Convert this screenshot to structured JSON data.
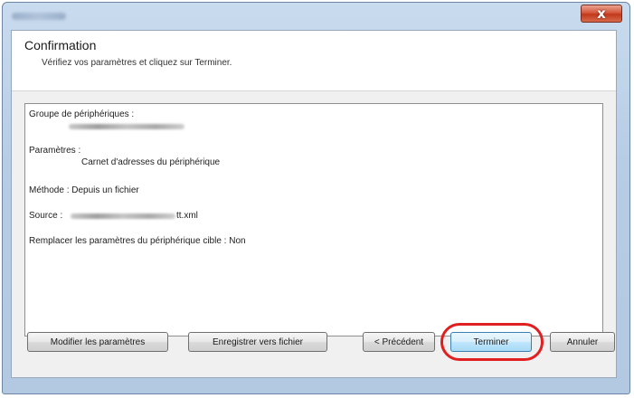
{
  "window": {
    "close_label": "x"
  },
  "header": {
    "title": "Confirmation",
    "subtitle": "Vérifiez vos paramètres et cliquez sur Terminer."
  },
  "summary": {
    "device_group_label": "Groupe de périphériques :",
    "settings_label": "Paramètres :",
    "settings_value": "Carnet d'adresses du périphérique",
    "method_line": "Méthode : Depuis un fichier",
    "source_label": "Source :",
    "source_suffix": "tt.xml",
    "replace_line": "Remplacer les paramètres du périphérique cible : Non"
  },
  "buttons": {
    "modify": "Modifier les paramètres",
    "save_to_file": "Enregistrer vers fichier",
    "previous": "< Précédent",
    "finish": "Terminer",
    "cancel": "Annuler"
  },
  "colors": {
    "highlight_ring": "#e02020",
    "close_button": "#c1381a"
  }
}
